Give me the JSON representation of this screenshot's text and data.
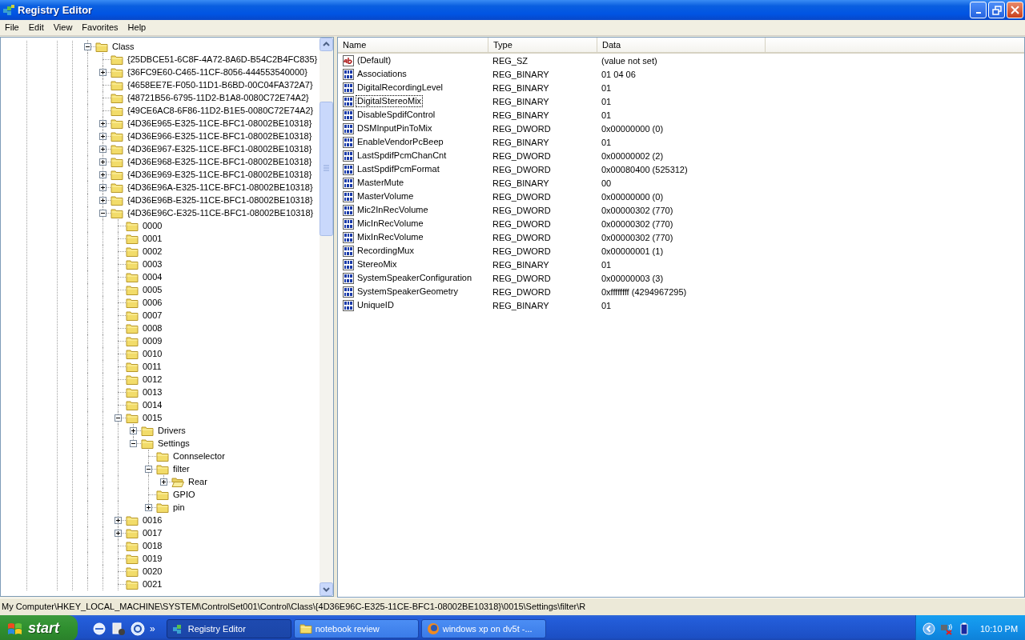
{
  "window": {
    "title": "Registry Editor"
  },
  "menu": [
    "File",
    "Edit",
    "View",
    "Favorites",
    "Help"
  ],
  "tree": [
    {
      "label": "Class",
      "expanded": true,
      "selected": false,
      "children": [
        {
          "label": "{25DBCE51-6C8F-4A72-8A6D-B54C2B4FC835}",
          "selected": false
        },
        {
          "label": "{36FC9E60-C465-11CF-8056-444553540000}",
          "expanded": false,
          "selected": false
        },
        {
          "label": "{4658EE7E-F050-11D1-B6BD-00C04FA372A7}",
          "selected": false
        },
        {
          "label": "{48721B56-6795-11D2-B1A8-0080C72E74A2}",
          "selected": false
        },
        {
          "label": "{49CE6AC8-6F86-11D2-B1E5-0080C72E74A2}",
          "selected": false
        },
        {
          "label": "{4D36E965-E325-11CE-BFC1-08002BE10318}",
          "expanded": false,
          "selected": false
        },
        {
          "label": "{4D36E966-E325-11CE-BFC1-08002BE10318}",
          "expanded": false,
          "selected": false
        },
        {
          "label": "{4D36E967-E325-11CE-BFC1-08002BE10318}",
          "expanded": false,
          "selected": false
        },
        {
          "label": "{4D36E968-E325-11CE-BFC1-08002BE10318}",
          "expanded": false,
          "selected": false
        },
        {
          "label": "{4D36E969-E325-11CE-BFC1-08002BE10318}",
          "expanded": false,
          "selected": false
        },
        {
          "label": "{4D36E96A-E325-11CE-BFC1-08002BE10318}",
          "expanded": false,
          "selected": false
        },
        {
          "label": "{4D36E96B-E325-11CE-BFC1-08002BE10318}",
          "expanded": false,
          "selected": false
        },
        {
          "label": "{4D36E96C-E325-11CE-BFC1-08002BE10318}",
          "expanded": true,
          "selected": false,
          "children": [
            {
              "label": "0000",
              "selected": false
            },
            {
              "label": "0001",
              "selected": false
            },
            {
              "label": "0002",
              "selected": false
            },
            {
              "label": "0003",
              "selected": false
            },
            {
              "label": "0004",
              "selected": false
            },
            {
              "label": "0005",
              "selected": false
            },
            {
              "label": "0006",
              "selected": false
            },
            {
              "label": "0007",
              "selected": false
            },
            {
              "label": "0008",
              "selected": false
            },
            {
              "label": "0009",
              "selected": false
            },
            {
              "label": "0010",
              "selected": false
            },
            {
              "label": "0011",
              "selected": false
            },
            {
              "label": "0012",
              "selected": false
            },
            {
              "label": "0013",
              "selected": false
            },
            {
              "label": "0014",
              "selected": false
            },
            {
              "label": "0015",
              "expanded": true,
              "selected": false,
              "children": [
                {
                  "label": "Drivers",
                  "expanded": false,
                  "selected": false
                },
                {
                  "label": "Settings",
                  "expanded": true,
                  "selected": false,
                  "children": [
                    {
                      "label": "Connselector",
                      "selected": false
                    },
                    {
                      "label": "filter",
                      "expanded": true,
                      "selected": false,
                      "children": [
                        {
                          "label": "Rear",
                          "expanded": false,
                          "selected": true
                        }
                      ]
                    },
                    {
                      "label": "GPIO",
                      "selected": false
                    },
                    {
                      "label": "pin",
                      "expanded": false,
                      "selected": false
                    }
                  ]
                }
              ]
            },
            {
              "label": "0016",
              "expanded": false,
              "selected": false
            },
            {
              "label": "0017",
              "expanded": false,
              "selected": false
            },
            {
              "label": "0018",
              "selected": false
            },
            {
              "label": "0019",
              "selected": false
            },
            {
              "label": "0020",
              "selected": false
            },
            {
              "label": "0021",
              "selected": false
            }
          ]
        }
      ]
    }
  ],
  "values": {
    "columns": [
      "Name",
      "Type",
      "Data"
    ],
    "rows": [
      {
        "kind": "string",
        "name": "(Default)",
        "type": "REG_SZ",
        "data": "(value not set)",
        "focused": false
      },
      {
        "kind": "binary",
        "name": "Associations",
        "type": "REG_BINARY",
        "data": "01 04 06",
        "focused": false
      },
      {
        "kind": "binary",
        "name": "DigitalRecordingLevel",
        "type": "REG_BINARY",
        "data": "01",
        "focused": false
      },
      {
        "kind": "binary",
        "name": "DigitalStereoMix",
        "type": "REG_BINARY",
        "data": "01",
        "focused": true
      },
      {
        "kind": "binary",
        "name": "DisableSpdifControl",
        "type": "REG_BINARY",
        "data": "01",
        "focused": false
      },
      {
        "kind": "binary",
        "name": "DSMInputPinToMix",
        "type": "REG_DWORD",
        "data": "0x00000000 (0)",
        "focused": false
      },
      {
        "kind": "binary",
        "name": "EnableVendorPcBeep",
        "type": "REG_BINARY",
        "data": "01",
        "focused": false
      },
      {
        "kind": "binary",
        "name": "LastSpdifPcmChanCnt",
        "type": "REG_DWORD",
        "data": "0x00000002 (2)",
        "focused": false
      },
      {
        "kind": "binary",
        "name": "LastSpdifPcmFormat",
        "type": "REG_DWORD",
        "data": "0x00080400 (525312)",
        "focused": false
      },
      {
        "kind": "binary",
        "name": "MasterMute",
        "type": "REG_BINARY",
        "data": "00",
        "focused": false
      },
      {
        "kind": "binary",
        "name": "MasterVolume",
        "type": "REG_DWORD",
        "data": "0x00000000 (0)",
        "focused": false
      },
      {
        "kind": "binary",
        "name": "Mic2InRecVolume",
        "type": "REG_DWORD",
        "data": "0x00000302 (770)",
        "focused": false
      },
      {
        "kind": "binary",
        "name": "MicInRecVolume",
        "type": "REG_DWORD",
        "data": "0x00000302 (770)",
        "focused": false
      },
      {
        "kind": "binary",
        "name": "MixInRecVolume",
        "type": "REG_DWORD",
        "data": "0x00000302 (770)",
        "focused": false
      },
      {
        "kind": "binary",
        "name": "RecordingMux",
        "type": "REG_DWORD",
        "data": "0x00000001 (1)",
        "focused": false
      },
      {
        "kind": "binary",
        "name": "StereoMix",
        "type": "REG_BINARY",
        "data": "01",
        "focused": false
      },
      {
        "kind": "binary",
        "name": "SystemSpeakerConfiguration",
        "type": "REG_DWORD",
        "data": "0x00000003 (3)",
        "focused": false
      },
      {
        "kind": "binary",
        "name": "SystemSpeakerGeometry",
        "type": "REG_DWORD",
        "data": "0xffffffff (4294967295)",
        "focused": false
      },
      {
        "kind": "binary",
        "name": "UniqueID",
        "type": "REG_BINARY",
        "data": "01",
        "focused": false
      }
    ]
  },
  "status_bar": "My Computer\\HKEY_LOCAL_MACHINE\\SYSTEM\\ControlSet001\\Control\\Class\\{4D36E96C-E325-11CE-BFC1-08002BE10318}\\0015\\Settings\\filter\\R",
  "taskbar": {
    "start": "start",
    "quick_launch_more": "»",
    "tasks": [
      {
        "kind": "regedit",
        "label": "Registry Editor",
        "selected": true
      },
      {
        "kind": "folder",
        "label": "notebook review",
        "selected": false
      },
      {
        "kind": "browser",
        "label": "windows xp on dv5t -...",
        "selected": false
      }
    ],
    "clock": "10:10 PM"
  }
}
